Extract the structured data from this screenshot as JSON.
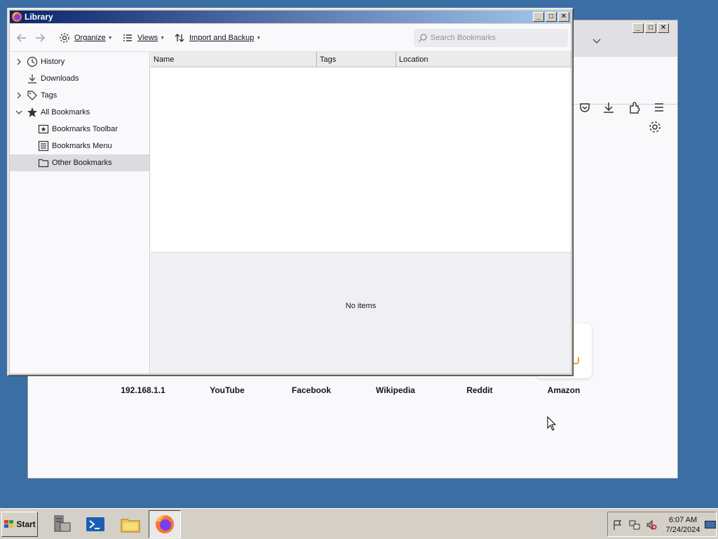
{
  "firefox": {
    "shortcuts": [
      {
        "label": "192.168.1.1"
      },
      {
        "label": "YouTube"
      },
      {
        "label": "Facebook"
      },
      {
        "label": "Wikipedia"
      },
      {
        "label": "Reddit"
      },
      {
        "label": "Amazon"
      }
    ]
  },
  "library": {
    "title": "Library",
    "toolbar": {
      "organize": "Organize",
      "views": "Views",
      "import_backup": "Import and Backup",
      "search_placeholder": "Search Bookmarks"
    },
    "tree": [
      {
        "label": "History",
        "icon": "clock-icon",
        "expandable": true,
        "expanded": false
      },
      {
        "label": "Downloads",
        "icon": "download-icon",
        "expandable": false
      },
      {
        "label": "Tags",
        "icon": "tag-icon",
        "expandable": true,
        "expanded": false
      },
      {
        "label": "All Bookmarks",
        "icon": "star-icon",
        "expandable": true,
        "expanded": true
      },
      {
        "label": "Bookmarks Toolbar",
        "icon": "bookmarks-toolbar-icon",
        "child": true
      },
      {
        "label": "Bookmarks Menu",
        "icon": "bookmarks-menu-icon",
        "child": true
      },
      {
        "label": "Other Bookmarks",
        "icon": "folder-icon",
        "child": true,
        "selected": true
      }
    ],
    "columns": [
      "Name",
      "Tags",
      "Location"
    ],
    "rows": [],
    "details_text": "No items"
  },
  "taskbar": {
    "start_label": "Start",
    "clock_time": "6:07 AM",
    "clock_date": "7/24/2024"
  },
  "colors": {
    "desktop": "#3a6ea5",
    "titlebar_start": "#0a246a",
    "titlebar_end": "#a6caf0",
    "selection": "#dcdce0"
  }
}
